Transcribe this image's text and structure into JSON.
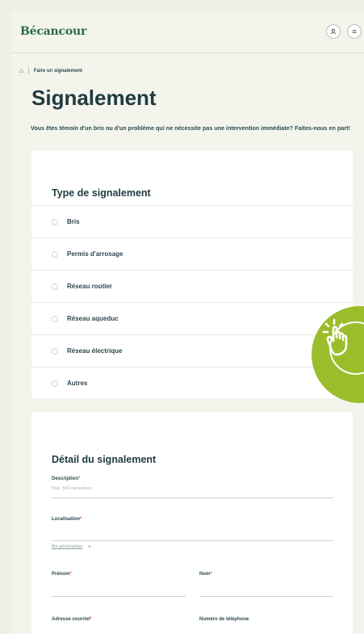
{
  "header": {
    "logo": "Bécancour",
    "user_icon": "user-icon",
    "menu_icon": "menu-icon"
  },
  "breadcrumb": {
    "home_icon": "home-icon",
    "current": "Faire un signalement"
  },
  "page": {
    "title": "Signalement",
    "intro": "Vous êtes témoin d'un bris ou d'un problème qui ne nécessite pas une intervention immédiate? Faites-nous en part!"
  },
  "type_section": {
    "title": "Type de signalement",
    "options": [
      "Bris",
      "Permis d'arrosage",
      "Réseau routier",
      "Réseau aqueduc",
      "Réseau électrique",
      "Autres"
    ]
  },
  "detail_section": {
    "title": "Détail du signalement",
    "description_label": "Description",
    "description_placeholder": "Max. 500 caractères",
    "localisation_label": "Localisation",
    "geolocate_link": "Me géolocaliser",
    "prenom_label": "Prénom",
    "nom_label": "Nom",
    "email_label": "Adresse courriel",
    "phone_label": "Numéro de téléphone",
    "required_mark": "*"
  },
  "badge": {
    "icon": "tap-hand-icon",
    "color": "#9bbd2b"
  }
}
